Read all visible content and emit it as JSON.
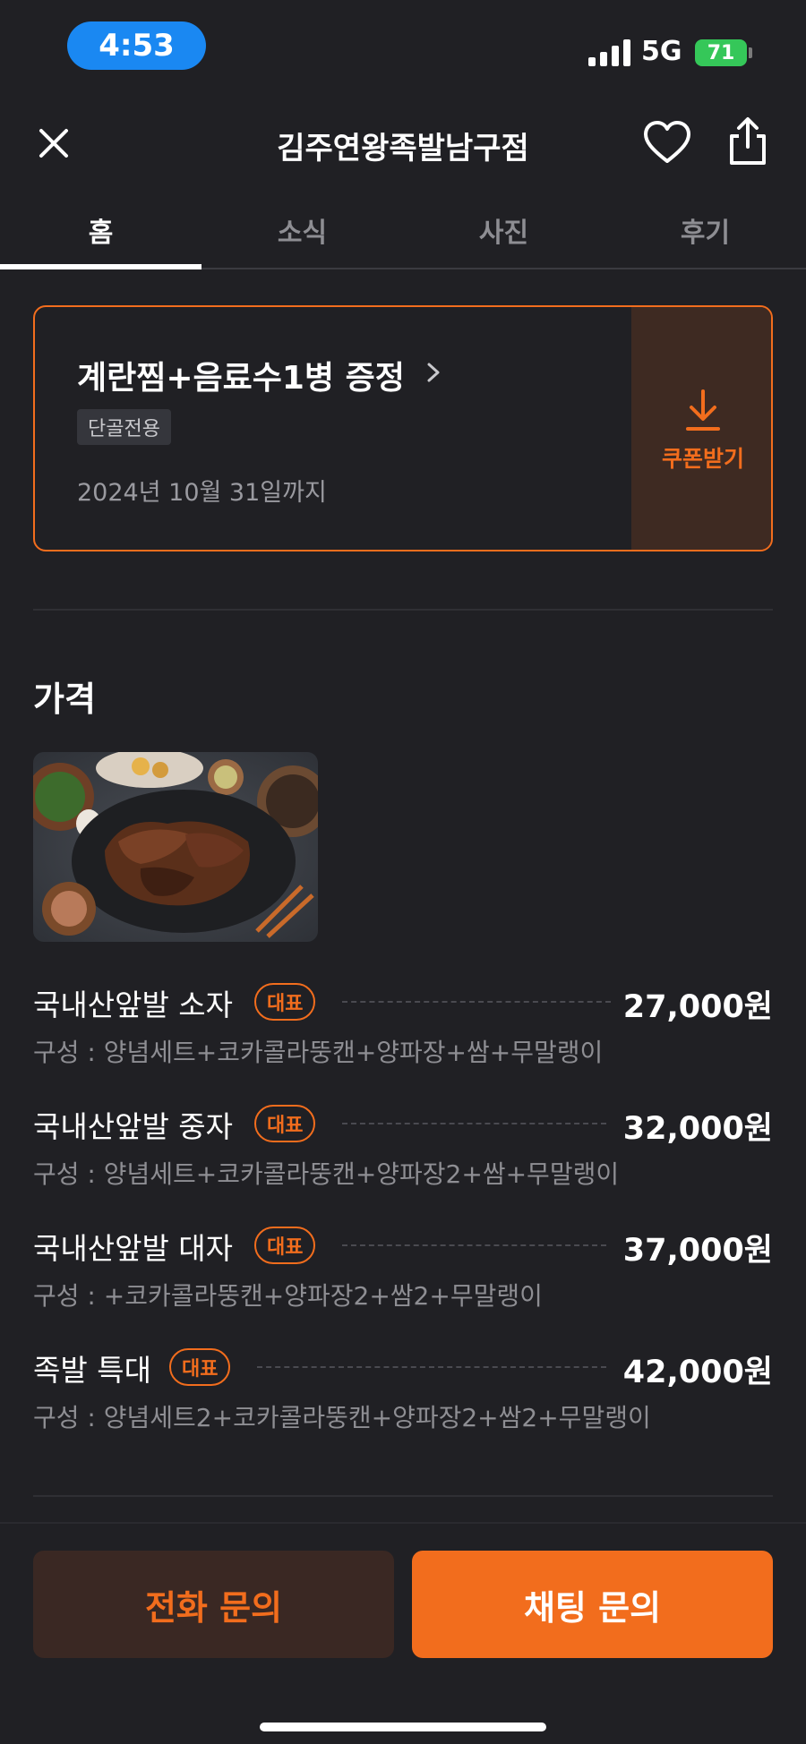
{
  "status_bar": {
    "time": "4:53",
    "network": "5G",
    "battery": "71"
  },
  "header": {
    "title": "김주연왕족발남구점"
  },
  "tabs": [
    {
      "label": "홈",
      "active": true
    },
    {
      "label": "소식",
      "active": false
    },
    {
      "label": "사진",
      "active": false
    },
    {
      "label": "후기",
      "active": false
    }
  ],
  "coupon": {
    "title": "계란찜+음료수1병 증정",
    "tag": "단골전용",
    "expiry": "2024년 10월 31일까지",
    "action_label": "쿠폰받기"
  },
  "price_section": {
    "title": "가격",
    "badge_label": "대표",
    "items": [
      {
        "name": "국내산앞발 소자",
        "badge": "대표",
        "price": "27,000원",
        "desc": "구성 : 양념세트+코카콜라뚱캔+양파장+쌈+무말랭이"
      },
      {
        "name": "국내산앞발 중자",
        "badge": "대표",
        "price": "32,000원",
        "desc": "구성 : 양념세트+코카콜라뚱캔+양파장2+쌈+무말랭이"
      },
      {
        "name": "국내산앞발 대자",
        "badge": "대표",
        "price": "37,000원",
        "desc": "구성 : +코카콜라뚱캔+양파장2+쌈2+무말랭이"
      },
      {
        "name": "족발 특대",
        "badge": "대표",
        "price": "42,000원",
        "desc": "구성 : 양념세트2+코카콜라뚱캔+양파장2+쌈2+무말랭이"
      }
    ]
  },
  "bottom_bar": {
    "call_label": "전화 문의",
    "chat_label": "채팅 문의"
  },
  "colors": {
    "background": "#202024",
    "accent": "#f26d1d",
    "time_pill": "#1a88f2",
    "battery": "#35c759"
  }
}
